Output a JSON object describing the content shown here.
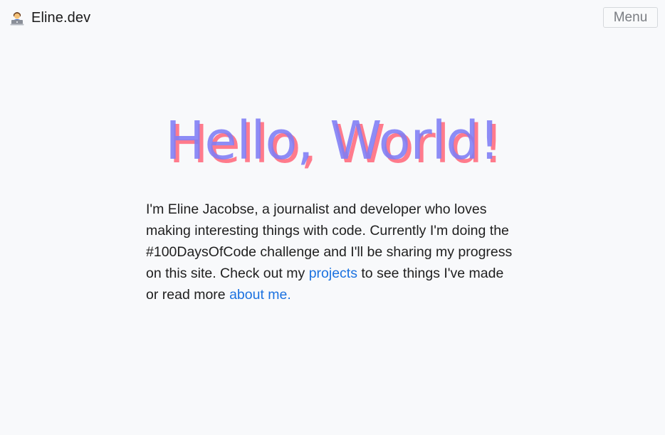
{
  "header": {
    "brand_emoji": "technologist-emoji",
    "brand_name": "Eline.dev",
    "menu_label": "Menu"
  },
  "hero": {
    "title": "Hello, World!",
    "colors": {
      "front": "#7f7ef6",
      "back": "#ff7b8c"
    }
  },
  "intro": {
    "text_1": "I'm Eline Jacobse, a journalist and developer who loves making interesting things with code. Currently I'm doing the #100DaysOfCode challenge and I'll be sharing my progress on this site. Check out my ",
    "link_projects": "projects",
    "text_2": " to see things I've made or read more ",
    "link_about": "about me."
  },
  "colors": {
    "background": "#f8f9fb",
    "link": "#1c72e0",
    "text": "#1f1f1f"
  }
}
